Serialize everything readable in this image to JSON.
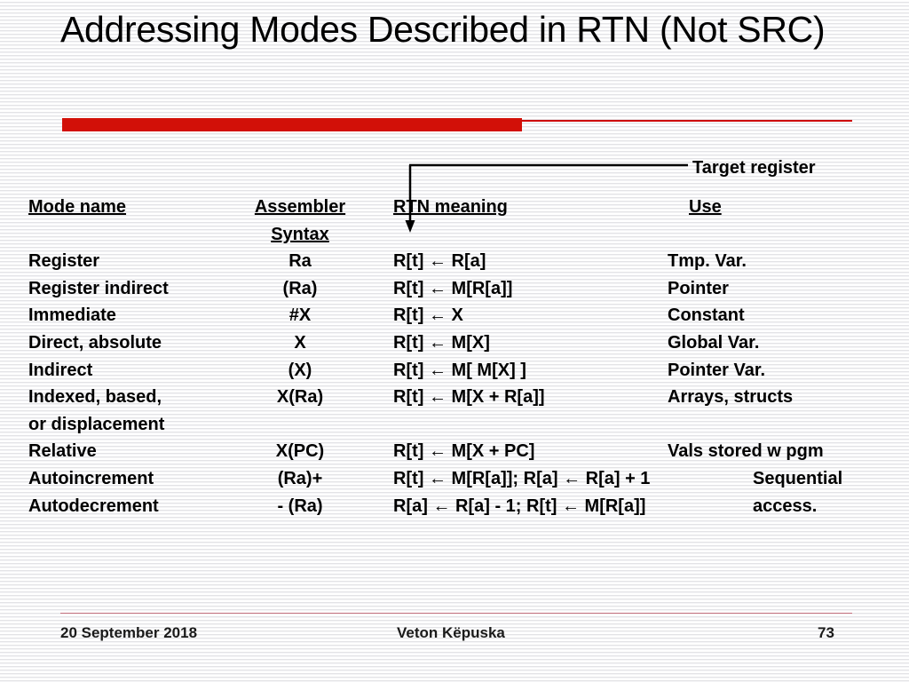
{
  "slide": {
    "title": "Addressing Modes Described in RTN (Not SRC)",
    "accent_color": "#d21008",
    "divider_line_color": "#cc0000",
    "footer_rule_color": "#c4707d"
  },
  "callout": {
    "label": "Target register",
    "arrow_icon": "down-arrow-leader-line"
  },
  "table": {
    "headers": {
      "mode_name": "Mode name",
      "assembler": "Assembler",
      "assembler_line2": "Syntax",
      "rtn_meaning": "RTN meaning",
      "use": "Use"
    },
    "rows": [
      {
        "mode": "Register",
        "syntax": "Ra",
        "rtn": "R[t] ← R[a]",
        "use": "Tmp. Var."
      },
      {
        "mode": "Register indirect",
        "syntax": "(Ra)",
        "rtn": "R[t] ← M[R[a]]",
        "use": "Pointer"
      },
      {
        "mode": "Immediate",
        "syntax": "#X",
        "rtn": "R[t] ← X",
        "use": "Constant"
      },
      {
        "mode": "Direct, absolute",
        "syntax": "X",
        "rtn": "R[t] ← M[X]",
        "use": "Global Var."
      },
      {
        "mode": "Indirect",
        "syntax": "(X)",
        "rtn": "R[t] ← M[ M[X] ]",
        "use": "Pointer Var."
      },
      {
        "mode": "Indexed, based,",
        "syntax": "X(Ra)",
        "rtn": "R[t] ← M[X + R[a]]",
        "use": "Arrays, structs"
      },
      {
        "mode": "or displacement",
        "syntax": "",
        "rtn": "",
        "use": ""
      },
      {
        "mode": "Relative",
        "syntax": "X(PC)",
        "rtn": "R[t] ← M[X + PC]",
        "use": "Vals stored w pgm"
      },
      {
        "mode": "Autoincrement",
        "syntax": "(Ra)+",
        "rtn": "R[t] ← M[R[a]]; R[a] ← R[a] + 1",
        "use": "Sequential"
      },
      {
        "mode": "Autodecrement",
        "syntax": "- (Ra)",
        "rtn": "R[a] ← R[a] - 1; R[t] ← M[R[a]]",
        "use": "access."
      }
    ]
  },
  "footer": {
    "date": "20 September 2018",
    "author": "Veton Këpuska",
    "page": "73"
  }
}
